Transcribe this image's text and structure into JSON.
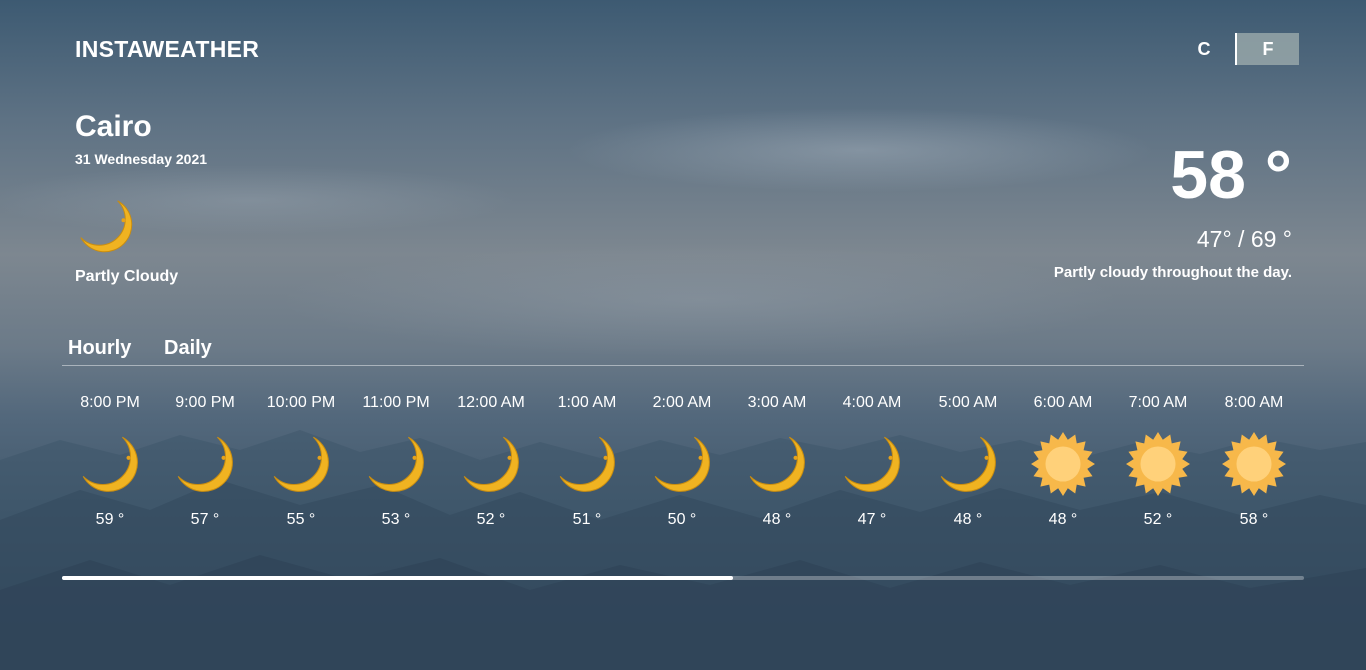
{
  "app": {
    "title": "INSTAWEATHER"
  },
  "units": {
    "celsius_label": "C",
    "fahrenheit_label": "F",
    "selected": "F"
  },
  "current": {
    "city": "Cairo",
    "date": "31 Wednesday 2021",
    "icon": "moon-icon",
    "condition": "Partly Cloudy",
    "temperature": "58 °",
    "range": "47° / 69 °",
    "summary": "Partly cloudy throughout the day."
  },
  "tabs": [
    {
      "label": "Hourly"
    },
    {
      "label": "Daily"
    }
  ],
  "hourly": [
    {
      "time": "8:00 PM",
      "temp": "59 °",
      "icon": "moon-icon"
    },
    {
      "time": "9:00 PM",
      "temp": "57 °",
      "icon": "moon-icon"
    },
    {
      "time": "10:00 PM",
      "temp": "55 °",
      "icon": "moon-icon"
    },
    {
      "time": "11:00 PM",
      "temp": "53 °",
      "icon": "moon-icon"
    },
    {
      "time": "12:00 AM",
      "temp": "52 °",
      "icon": "moon-icon"
    },
    {
      "time": "1:00 AM",
      "temp": "51 °",
      "icon": "moon-icon"
    },
    {
      "time": "2:00 AM",
      "temp": "50 °",
      "icon": "moon-icon"
    },
    {
      "time": "3:00 AM",
      "temp": "48 °",
      "icon": "moon-icon"
    },
    {
      "time": "4:00 AM",
      "temp": "47 °",
      "icon": "moon-icon"
    },
    {
      "time": "5:00 AM",
      "temp": "48 °",
      "icon": "moon-icon"
    },
    {
      "time": "6:00 AM",
      "temp": "48 °",
      "icon": "sun-icon"
    },
    {
      "time": "7:00 AM",
      "temp": "52 °",
      "icon": "sun-icon"
    },
    {
      "time": "8:00 AM",
      "temp": "58 °",
      "icon": "sun-icon"
    }
  ],
  "scroll": {
    "position_fraction": 0.54
  },
  "colors": {
    "moon": "#f0b321",
    "sun_outer": "#f7b84a",
    "sun_inner": "#ffd17a"
  }
}
